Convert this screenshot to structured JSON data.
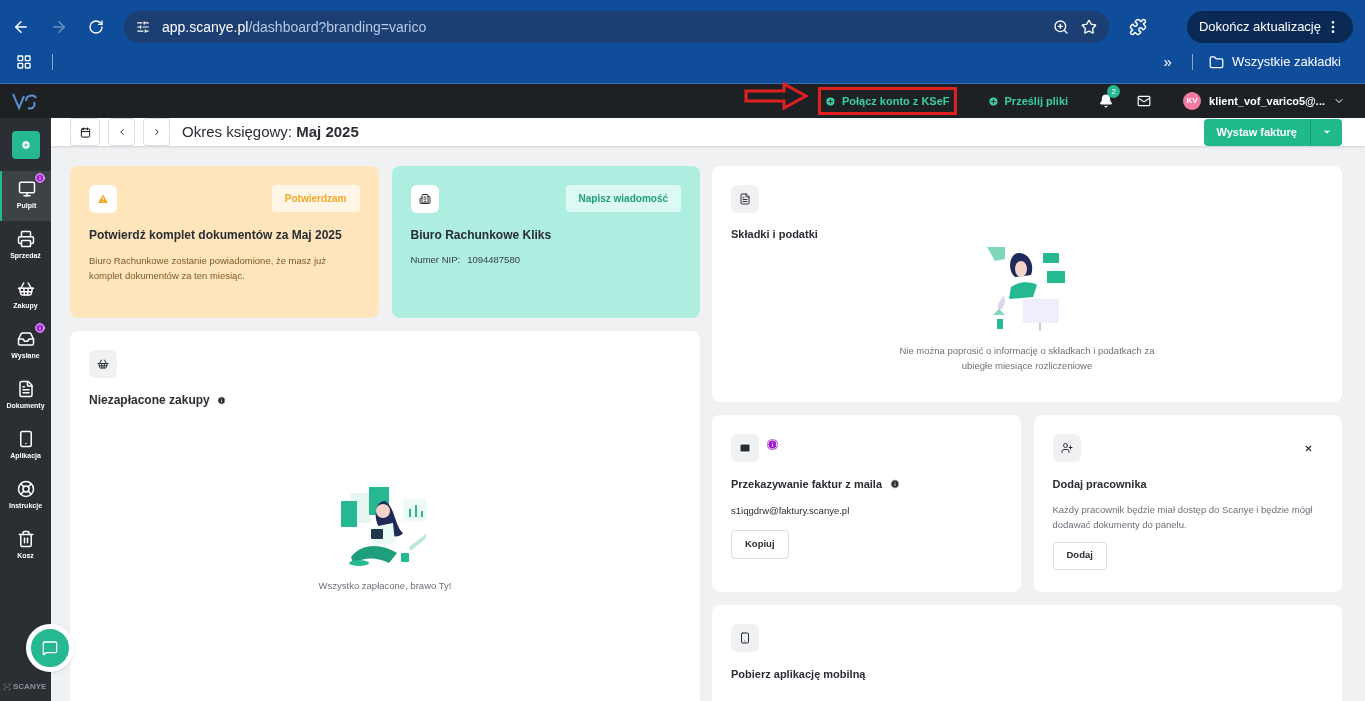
{
  "browser": {
    "url_host": "app.scanye.pl",
    "url_path": "/dashboard?branding=varico",
    "forward_disabled": true,
    "update_button": "Dokończ aktualizację",
    "bookmarks_overflow": "»",
    "bookmarks_folder": "Wszystkie zakładki"
  },
  "topbar": {
    "actions": [
      {
        "label": "Połącz konto z KSeF",
        "annotated": true
      },
      {
        "label": "Prześlij pliki",
        "annotated": false
      }
    ],
    "notifications_count": "2",
    "avatar": "KV",
    "user": "klient_vof_varico5@..."
  },
  "sidebar": {
    "items": [
      {
        "label": "Pulpit",
        "selected": true,
        "info": true
      },
      {
        "label": "Sprzedaż",
        "selected": false,
        "info": false
      },
      {
        "label": "Zakupy",
        "selected": false,
        "info": false
      },
      {
        "label": "Wysłane",
        "selected": false,
        "info": true
      },
      {
        "label": "Dokumenty",
        "selected": false,
        "info": false
      },
      {
        "label": "Aplikacja",
        "selected": false,
        "info": false
      },
      {
        "label": "Instrukcje",
        "selected": false,
        "info": false
      },
      {
        "label": "Kosz",
        "selected": false,
        "info": false
      }
    ],
    "brand": "SCANYE"
  },
  "header": {
    "period_label": "Okres księgowy:",
    "period_value": "Maj 2025",
    "primary_button": "Wystaw fakturę"
  },
  "cards": {
    "confirm": {
      "button": "Potwierdzam",
      "title": "Potwierdź komplet dokumentów za Maj 2025",
      "text": "Biuro Rachunkowe zostanie powiadomione, że masz już komplet dokumentów za ten miesiąc."
    },
    "office": {
      "button": "Napisz wiadomość",
      "title": "Biuro Rachunkowe Kliks",
      "nip_label": "Numer NIP:",
      "nip": "1094487580"
    },
    "unpaid": {
      "title": "Niezapłacone zakupy",
      "empty": "Wszystko zapłacone, brawo Ty!"
    },
    "taxes": {
      "title": "Składki i podatki",
      "empty": "Nie można poprosić o informację o składkach i podatkach za ubiegłe miesiące rozliczeniowe"
    },
    "email": {
      "title": "Przekazywanie faktur z maila",
      "address": "s1iqgdrw@faktury.scanye.pl",
      "button": "Kopiuj"
    },
    "employee": {
      "title": "Dodaj pracownika",
      "text": "Każdy pracownik będzie miał dostęp do Scanye i będzie mógł dodawać dokumenty do panelu.",
      "button": "Dodaj"
    },
    "mobile": {
      "title": "Pobierz aplikację mobilną"
    }
  }
}
